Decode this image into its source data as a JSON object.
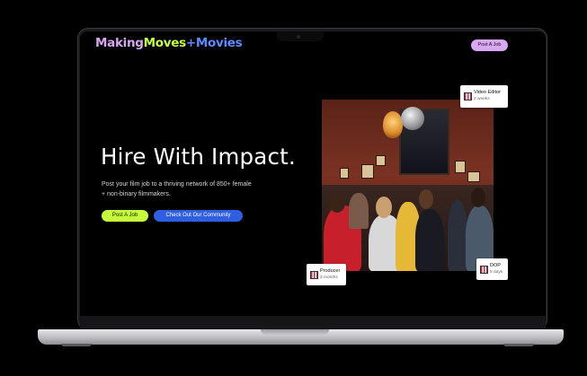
{
  "header": {
    "logo_part1": "Making",
    "logo_part2": "Moves",
    "logo_part3": "+Movies",
    "post_job_label": "Post A Job"
  },
  "hero": {
    "headline": "Hire With Impact.",
    "subtext": "Post your film job to a thriving network of 850+ female + non-binary filmmakers.",
    "primary_button": "Post A Job",
    "secondary_button": "Check Out Our Community"
  },
  "job_cards": [
    {
      "role": "Video Editor",
      "time": "2 weeks"
    },
    {
      "role": "Producer",
      "time": "3 months"
    },
    {
      "role": "DOP",
      "time": "5 days"
    }
  ],
  "colors": {
    "accent_lime": "#c6ff3a",
    "accent_lilac": "#d9a8f3",
    "accent_blue": "#2f5fe0",
    "background": "#000000"
  }
}
